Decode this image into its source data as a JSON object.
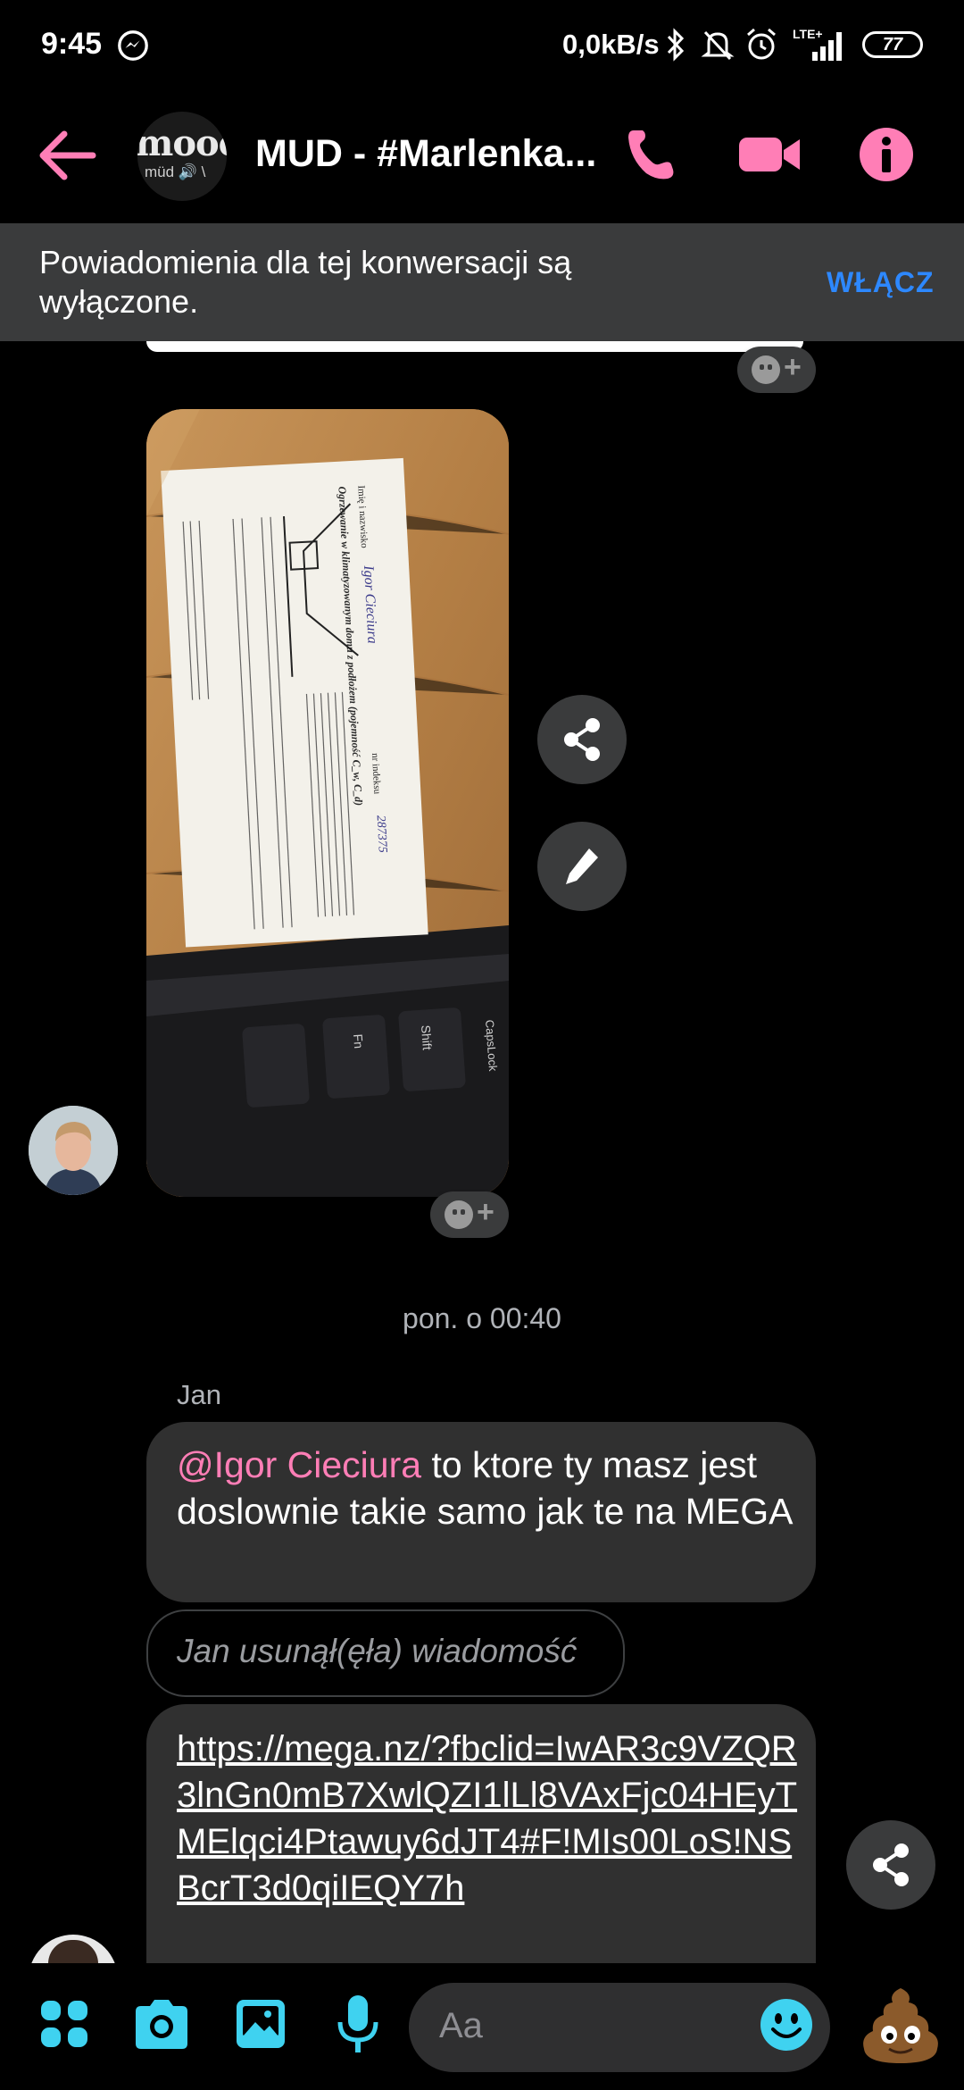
{
  "status_bar": {
    "time": "9:45",
    "network_speed": "0,0kB/s",
    "network_type": "LTE+",
    "battery": "77"
  },
  "header": {
    "title": "MUD - #Marlenka...",
    "avatar_logo": "mooc",
    "avatar_logo_small": "müd 🔊 \\",
    "accent_color": "#ff7eb6"
  },
  "notification": {
    "text": "Powiadomienia dla tej konwersacji są wyłączone.",
    "action": "WŁĄCZ"
  },
  "chat": {
    "timestamp": "pon. o 00:40",
    "sender": "Jan",
    "photo": {
      "form_title": "Ogrzewanie w klimatyzowanym domu z podłożem (pojemność C_w, C_d)",
      "name_label": "Imię i nazwisko",
      "handwritten_name": "Igor Cieciura",
      "index_label": "nr indeksu",
      "handwritten_index": "287375",
      "keys": [
        "Fn",
        "Shift",
        "CapsLock"
      ]
    },
    "messages": [
      {
        "mention": "@Igor Cieciura",
        "text": " to ktore ty masz jest doslownie takie samo jak te na MEGA"
      },
      {
        "deleted_text": "Jan usunął(ęła) wiadomość"
      },
      {
        "link": "https://mega.nz/?fbclid=IwAR3c9VZQR3lnGn0mB7XwlQZI1lLl8VAxFjc04HEyTMElqci4Ptawuy6dJT4#F!MIs00LoS!NSBcrT3d0qiIEQY7h"
      }
    ]
  },
  "composer": {
    "placeholder": "Aa",
    "icons": [
      "more-icon",
      "camera-icon",
      "gallery-icon",
      "mic-icon",
      "emoji-icon",
      "poop-emoji-icon"
    ],
    "icon_color": "#3fd2f0"
  }
}
